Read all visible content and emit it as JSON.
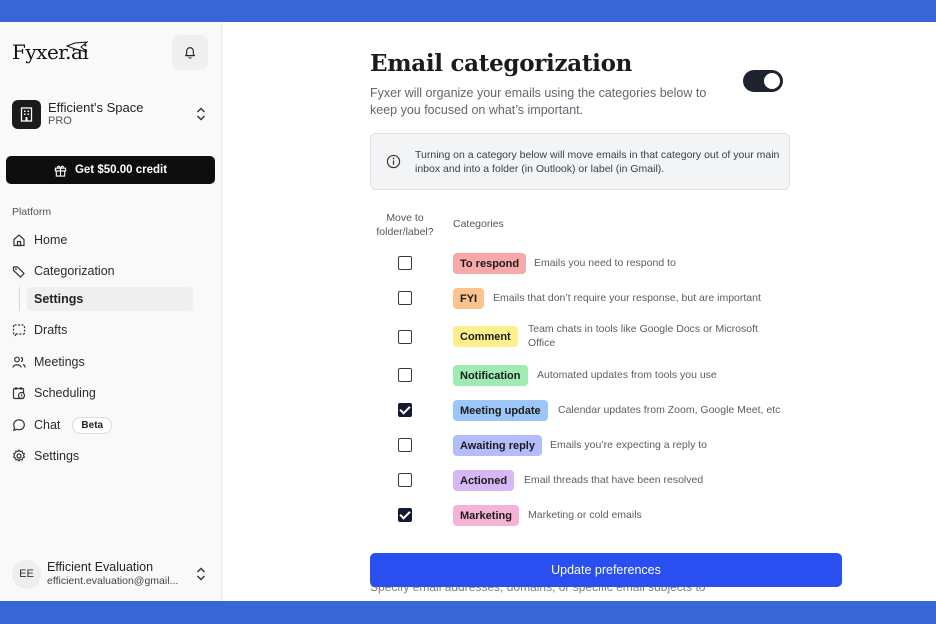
{
  "sidebar": {
    "logo": "Fyxer.ai",
    "workspace": {
      "name": "Efficient's Space",
      "plan": "PRO"
    },
    "credit_button": "Get $50.00 credit",
    "section_label": "Platform",
    "nav": [
      {
        "label": "Home",
        "icon": "home-icon"
      },
      {
        "label": "Categorization",
        "icon": "tag-icon"
      },
      {
        "label": "Drafts",
        "icon": "drafts-icon"
      },
      {
        "label": "Meetings",
        "icon": "people-icon"
      },
      {
        "label": "Scheduling",
        "icon": "calendar-clock-icon"
      },
      {
        "label": "Chat",
        "icon": "chat-bubble-icon",
        "badge": "Beta"
      },
      {
        "label": "Settings",
        "icon": "gear-icon"
      }
    ],
    "sub_item": "Settings",
    "user": {
      "initials": "EE",
      "name": "Efficient Evaluation",
      "email": "efficient.evaluation@gmail..."
    }
  },
  "main": {
    "title": "Email categorization",
    "description": "Fyxer will organize your emails using the categories below to keep you focused on what’s important.",
    "toggle_on": true,
    "info": "Turning on a category below will move emails in that category out of your main inbox and into a folder (in Outlook) or label (in Gmail).",
    "col_move": "Move to folder/label?",
    "col_categories": "Categories",
    "categories": [
      {
        "name": "To respond",
        "desc": "Emails you need to respond to",
        "checked": false,
        "color": "#f7a8a8"
      },
      {
        "name": "FYI",
        "desc": "Emails that don’t require your response, but are important",
        "checked": false,
        "color": "#fbc48d"
      },
      {
        "name": "Comment",
        "desc": "Team chats in tools like Google Docs or Microsoft Office",
        "checked": false,
        "color": "#fdf08c"
      },
      {
        "name": "Notification",
        "desc": "Automated updates from tools you use",
        "checked": false,
        "color": "#9eecb4"
      },
      {
        "name": "Meeting update",
        "desc": "Calendar updates from Zoom, Google Meet, etc",
        "checked": true,
        "color": "#9cc6f7"
      },
      {
        "name": "Awaiting reply",
        "desc": "Emails you’re expecting a reply to",
        "checked": false,
        "color": "#b3bdfb"
      },
      {
        "name": "Actioned",
        "desc": "Email threads that have been resolved",
        "checked": false,
        "color": "#d7b8f6"
      },
      {
        "name": "Marketing",
        "desc": "Marketing or cold emails",
        "checked": true,
        "color": "#f6b3d8"
      }
    ],
    "update_button": "Update preferences",
    "behind_text": "Specify email addresses, domains, or specific email subjects to"
  }
}
